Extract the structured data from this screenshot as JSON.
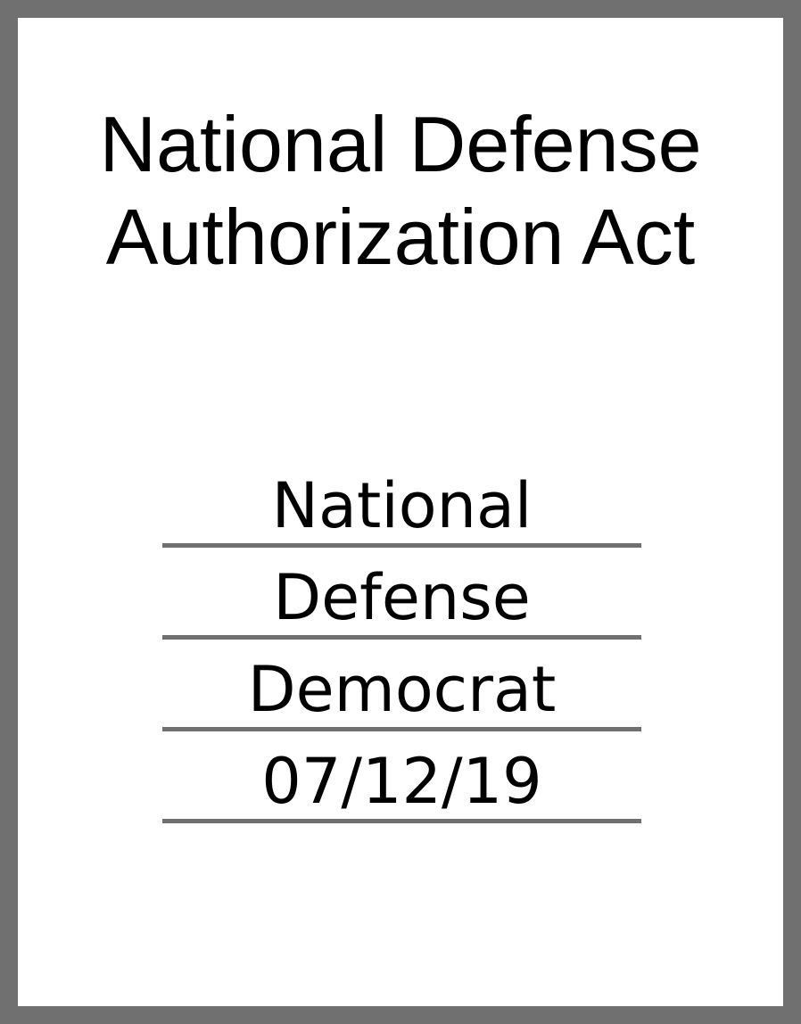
{
  "document": {
    "title_line_1": "National Defense",
    "title_line_2": "Authorization Act",
    "fields": [
      "National",
      "Defense",
      "Democrat",
      "07/12/19"
    ]
  }
}
